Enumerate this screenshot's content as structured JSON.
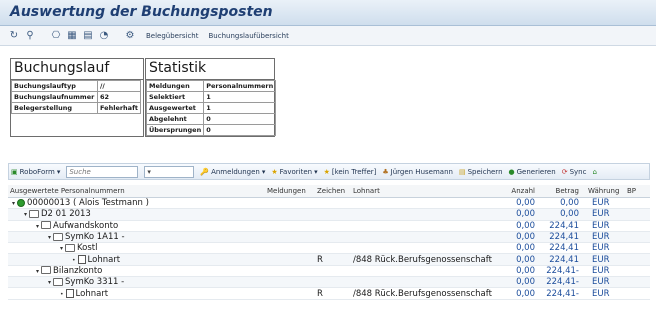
{
  "title": "Auswertung der Buchungsposten",
  "toolbar": {
    "links": [
      "Belegübersicht",
      "Buchungslaufübersicht"
    ]
  },
  "buchungslauf": {
    "title": "Buchungslauf",
    "rows": [
      {
        "label": "Buchungslauftyp",
        "value": "//"
      },
      {
        "label": "Buchungslaufnummer",
        "value": "62"
      },
      {
        "label": "Belegerstellung",
        "value": "Fehlerhaft"
      }
    ]
  },
  "statistik": {
    "title": "Statistik",
    "header": {
      "label": "Meldungen",
      "value": "Personalnummern"
    },
    "rows": [
      {
        "label": "Selektiert",
        "value": "1"
      },
      {
        "label": "Ausgewertet",
        "value": "1"
      },
      {
        "label": "Abgelehnt",
        "value": "0"
      },
      {
        "label": "Übersprungen",
        "value": "0"
      }
    ]
  },
  "grid_toolbar": {
    "roboform": "RoboForm",
    "search_placeholder": "Suche",
    "anmeldungen": "Anmeldungen",
    "favoriten": "Favoriten",
    "treffer": "[kein Treffer]",
    "user": "Jürgen Husemann",
    "speichern": "Speichern",
    "generieren": "Generieren",
    "sync": "Sync"
  },
  "columns": [
    "Ausgewertete Personalnummern",
    "Meldungen",
    "Zeichen",
    "Lohnart",
    "Anzahl",
    "Betrag",
    "Währung",
    "BP"
  ],
  "rows": [
    {
      "label": "00000013 ( Alois Testmann )",
      "icon": "green-dot",
      "level": 0,
      "meldungen": "",
      "zeichen": "",
      "lohnart": "",
      "anzahl": "0,00",
      "betrag": "0,00",
      "waehrung": "EUR"
    },
    {
      "label": "D2 01 2013",
      "icon": "folder",
      "level": 1,
      "meldungen": "",
      "zeichen": "",
      "lohnart": "",
      "anzahl": "0,00",
      "betrag": "0,00",
      "waehrung": "EUR"
    },
    {
      "label": "Aufwandskonto",
      "icon": "folder",
      "level": 2,
      "meldungen": "",
      "zeichen": "",
      "lohnart": "",
      "anzahl": "0,00",
      "betrag": "224,41",
      "waehrung": "EUR"
    },
    {
      "label": "SymKo 1A11 -",
      "icon": "folder",
      "level": 3,
      "meldungen": "",
      "zeichen": "",
      "lohnart": "",
      "anzahl": "0,00",
      "betrag": "224,41",
      "waehrung": "EUR"
    },
    {
      "label": "Kostl",
      "icon": "folder",
      "level": 4,
      "meldungen": "",
      "zeichen": "",
      "lohnart": "",
      "anzahl": "0,00",
      "betrag": "224,41",
      "waehrung": "EUR"
    },
    {
      "label": "Lohnart",
      "icon": "doc",
      "level": 5,
      "meldungen": "",
      "zeichen": "R",
      "lohnart": "/848 Rück.Berufsgenossenschaft",
      "anzahl": "0,00",
      "betrag": "224,41",
      "waehrung": "EUR"
    },
    {
      "label": "Bilanzkonto",
      "icon": "folder",
      "level": 2,
      "meldungen": "",
      "zeichen": "",
      "lohnart": "",
      "anzahl": "0,00",
      "betrag": "224,41-",
      "waehrung": "EUR"
    },
    {
      "label": "SymKo 3311 -",
      "icon": "folder",
      "level": 3,
      "meldungen": "",
      "zeichen": "",
      "lohnart": "",
      "anzahl": "0,00",
      "betrag": "224,41-",
      "waehrung": "EUR"
    },
    {
      "label": "Lohnart",
      "icon": "doc",
      "level": 4,
      "meldungen": "",
      "zeichen": "R",
      "lohnart": "/848 Rück.Berufsgenossenschaft",
      "anzahl": "0,00",
      "betrag": "224,41-",
      "waehrung": "EUR"
    }
  ]
}
